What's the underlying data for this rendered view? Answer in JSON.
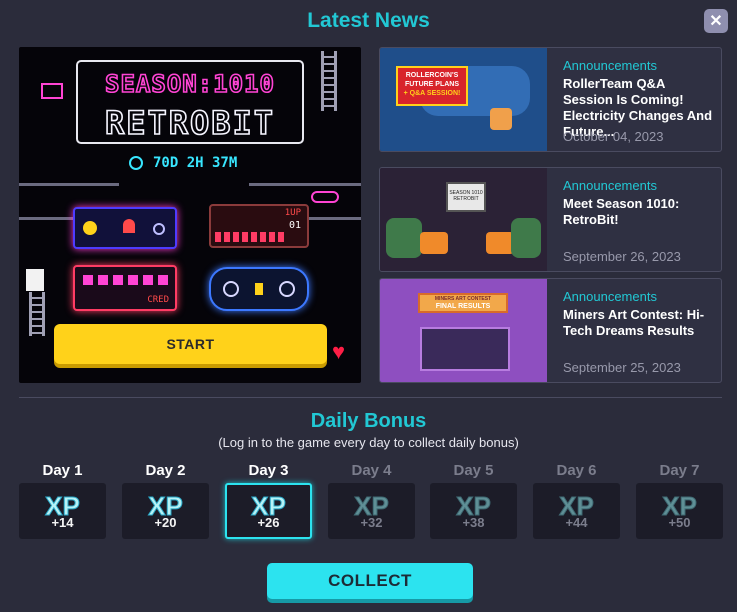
{
  "header": {
    "title": "Latest News",
    "close_label": "✕"
  },
  "featured": {
    "title_line1": "SEASON:1010",
    "title_line2": "RETROBIT",
    "timer": "70D 2H 37M",
    "start_label": "START",
    "arcade_texts": {
      "up": "1UP",
      "score": "01",
      "cred": "CRED"
    }
  },
  "news": [
    {
      "category": "Announcements",
      "headline": "RollerTeam Q&A Session Is Coming! Electricity Changes And Future...",
      "date": "October 04, 2023",
      "thumb_title": "ROLLERCOIN'S FUTURE PLANS",
      "thumb_sub": "+ Q&A SESSION!"
    },
    {
      "category": "Announcements",
      "headline": "Meet Season 1010: RetroBit!",
      "date": "September 26, 2023",
      "thumb_title": "SEASON 1010 RETROBIT"
    },
    {
      "category": "Announcements",
      "headline": "Miners Art Contest: Hi-Tech Dreams Results",
      "date": "September 25, 2023",
      "thumb_title": "FINAL RESULTS",
      "thumb_sub": "MINERS ART CONTEST"
    }
  ],
  "bonus": {
    "title": "Daily Bonus",
    "subtitle": "(Log in to the game every day to collect daily bonus)",
    "xp_label": "XP",
    "days": [
      {
        "label": "Day 1",
        "amount": "+14",
        "state": "claimed"
      },
      {
        "label": "Day 2",
        "amount": "+20",
        "state": "claimed"
      },
      {
        "label": "Day 3",
        "amount": "+26",
        "state": "active"
      },
      {
        "label": "Day 4",
        "amount": "+32",
        "state": "locked"
      },
      {
        "label": "Day 5",
        "amount": "+38",
        "state": "locked"
      },
      {
        "label": "Day 6",
        "amount": "+44",
        "state": "locked"
      },
      {
        "label": "Day 7",
        "amount": "+50",
        "state": "locked"
      }
    ],
    "collect_label": "COLLECT"
  },
  "colors": {
    "accent": "#22c8d4",
    "start": "#ffd21a",
    "collect": "#2ce3ef",
    "background": "#2b2c3b"
  }
}
